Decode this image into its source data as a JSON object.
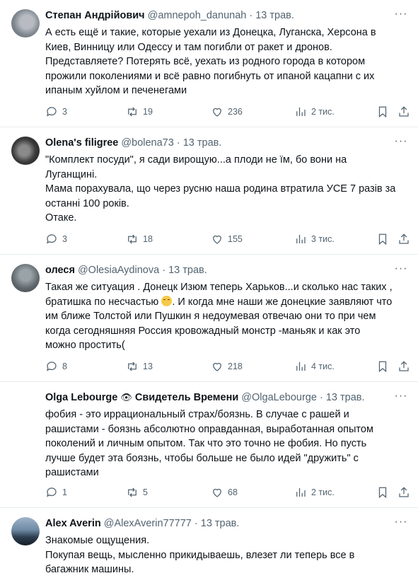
{
  "tweets": [
    {
      "name": "Степан Андрійович",
      "handle": "@amnepoh_danunah",
      "dot": "·",
      "date": "13 трав.",
      "lines": [
        "А есть ещё и такие, которые уехали из Донецка, Луганска, Херсона в",
        "Киев, Винницу или Одессу и там погибли от ракет и дронов.",
        "Представляете? Потерять всё, уехать из родного города в котором",
        "прожили поколениями и всё равно погибнуть от ипаной кацапни с их",
        "ипаным хуйлом и печенегами"
      ],
      "replies": "3",
      "retweets": "19",
      "likes": "236",
      "views": "2 тис."
    },
    {
      "name": "Olena's filigree",
      "handle": "@bolena73",
      "dot": "·",
      "date": "13 трав.",
      "lines": [
        "\"Комплект посуди\", я сади вирощую...а плоди не їм, бо вони на",
        "Луганщині.",
        "Мама порахувала, що через русню наша родина втратила УСЕ 7 разів за",
        "останні 100 років.",
        "Отаке."
      ],
      "replies": "3",
      "retweets": "18",
      "likes": "155",
      "views": "3 тис."
    },
    {
      "name": "олеся",
      "handle": "@OlesiaAydinova",
      "dot": "·",
      "date": "13 трав.",
      "line1": "Такая же ситуация . Донецк Изюм теперь Харьков...и сколько нас таких ,",
      "line2a": "братишка по несчастью ",
      "line2b": ". И когда мне наши же донецкие заявляют что",
      "line3": "им ближе Толстой или Пушкин я недоумевая отвечаю они то при чем",
      "line4": "когда сегодняшняя Россия кровожадный монстр -маньяк и как это",
      "line5": "можно простить(",
      "replies": "8",
      "retweets": "13",
      "likes": "218",
      "views": "4 тис."
    },
    {
      "name": "Olga Lebourge",
      "eye": "👁",
      "name2": "Свидетель Времени",
      "handle": "@OlgaLebourge",
      "dot": "·",
      "date": "13 трав.",
      "lines": [
        "фобия - это иррациональный страх/боязнь. В случае с рашей и",
        "рашистами - боязнь абсолютно оправданная, выработанная опытом",
        "поколений и личным опытом. Так что это точно не фобия. Но пусть",
        "лучше будет эта боязнь, чтобы больше не было идей \"дружить\" с",
        "рашистами"
      ],
      "replies": "1",
      "retweets": "5",
      "likes": "68",
      "views": "2 тис."
    },
    {
      "name": "Alex Averin",
      "handle": "@AlexAverin77777",
      "dot": "·",
      "date": "13 трав.",
      "lines": [
        "Знакомые ощущения.",
        "Покупая вещь, мысленно прикидываешь, влезет ли теперь все в",
        "багажник машины."
      ]
    }
  ],
  "more_label": "···"
}
